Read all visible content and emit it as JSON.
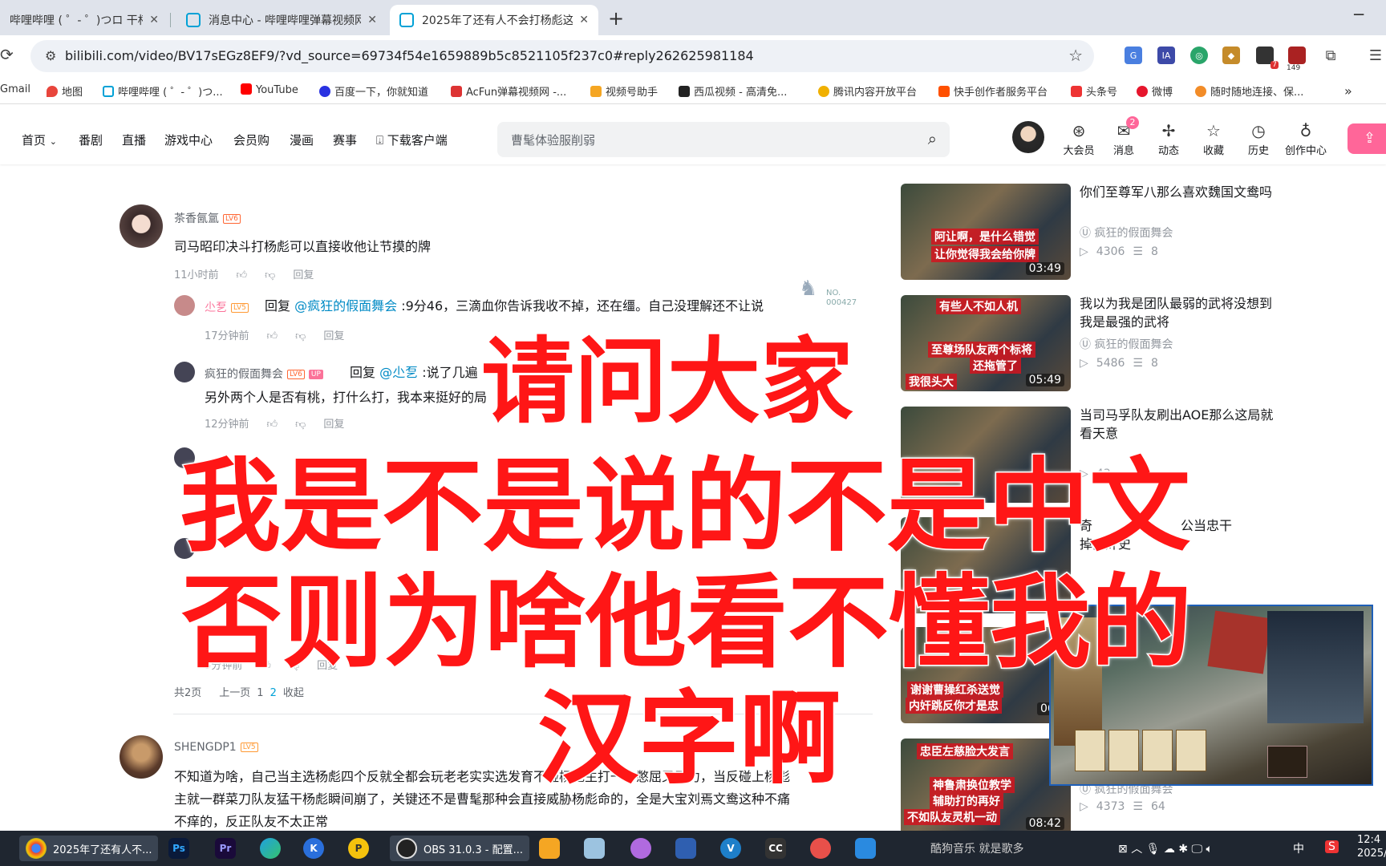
{
  "browser": {
    "tabs": [
      {
        "title": "哔哩哔哩 ( ゜- ゜)つロ 干杯~-bi",
        "close": "✕"
      },
      {
        "title": "消息中心 - 哔哩哔哩弹幕视频网",
        "close": "✕"
      },
      {
        "title": "2025年了还有人不会打杨彪这",
        "close": "✕"
      }
    ],
    "new_tab": "+",
    "minimize": "─",
    "url": "bilibili.com/video/BV17sEGz8EF9/?vd_source=69734f54e1659889b5c8521105f237c0#reply262625981184",
    "ext_badges": {
      "notif": "7",
      "count": "149"
    },
    "bookmarks": [
      "Gmail",
      "地图",
      "哔哩哔哩 ( ゜- ゜)つ...",
      "YouTube",
      "百度一下，你就知道",
      "AcFun弹幕视频网 -...",
      "视频号助手",
      "西瓜视频 - 高清免...",
      "腾讯内容开放平台",
      "快手创作者服务平台",
      "头条号",
      "微博",
      "随时随地连接、保..."
    ],
    "bookmarks_more": "»"
  },
  "header": {
    "nav": [
      "首页",
      "番剧",
      "直播",
      "游戏中心",
      "会员购",
      "漫画",
      "赛事",
      "下载客户端"
    ],
    "search_placeholder": "曹髦体验服削弱",
    "icons": [
      {
        "label": "大会员",
        "glyph": "⊛"
      },
      {
        "label": "消息",
        "glyph": "✉",
        "badge": "2"
      },
      {
        "label": "动态",
        "glyph": "✢"
      },
      {
        "label": "收藏",
        "glyph": "☆"
      },
      {
        "label": "历史",
        "glyph": "◷"
      },
      {
        "label": "创作中心",
        "glyph": "♁"
      }
    ]
  },
  "comments": {
    "main": {
      "user": "茶香氤氲",
      "level": "LV6",
      "text": "司马昭印决斗打杨彪可以直接收他让节摸的牌",
      "time": "11小时前",
      "reply": "回复",
      "fan_no": "NO.",
      "fan_id": "000427"
    },
    "replies": [
      {
        "user": "尐乭",
        "level": "LV5",
        "prefix": "回复",
        "at": "@疯狂的假面舞会",
        "text": ":9分46，三滴血你告诉我收不掉，还在缰。自己没理解还不让说",
        "time": "17分钟前",
        "reply": "回复"
      },
      {
        "user": "疯狂的假面舞会",
        "level": "LV6",
        "up": "UP",
        "prefix": "回复",
        "at": "@尐乭",
        "text": ":说了几遍",
        "text2": "另外两个人是否有桃，打什么打，我本来挺好的局",
        "time": "12分钟前",
        "reply": "回复"
      },
      {
        "time": "5分钟前",
        "reply": "回复"
      }
    ],
    "pager": {
      "total": "共2页",
      "prev": "上一页",
      "p1": "1",
      "p2": "2",
      "collapse": "收起"
    },
    "second": {
      "user": "SHENGDP1",
      "level": "LV5",
      "line1": "不知道为啥，自己当主选杨彪四个反就全都会玩老老实实选发育不碰杨彪主打一个憋屈又无力，当反碰上杨彪",
      "line2": "主就一群菜刀队友猛干杨彪瞬间崩了，关键还不是曹髦那种会直接威胁杨彪命的，全是大宝刘焉文鸯这种不痛",
      "line3": "不痒的，反正队友不太正常"
    }
  },
  "recommend": [
    {
      "title": "你们至尊军八那么喜欢魏国文鸯吗",
      "up": "疯狂的假面舞会",
      "views": "4306",
      "danmaku": "8",
      "duration": "03:49",
      "cap1": "阿让啊，是什么错觉",
      "cap2": "让你觉得我会给你牌"
    },
    {
      "title": "我以为我是团队最弱的武将没想到我是最强的武将",
      "up": "疯狂的假面舞会",
      "views": "5486",
      "danmaku": "8",
      "duration": "05:49",
      "cap1": "有些人不如人机",
      "cap2": "至尊场队友两个标将",
      "cap3": "还拖管了",
      "cap4": "我很头大"
    },
    {
      "title": "当司马孚队友刷出AOE那么这局就看天意",
      "views": "43",
      "duration": ""
    },
    {
      "title": "奇",
      "title2": "公当忠干",
      "title3": "掉内奸史",
      "duration": "06",
      "cap1": "谢谢曹操红杀送觉",
      "cap2": "内奸跳反你才是忠"
    },
    {
      "title": "",
      "up": "疯狂的假面舞会",
      "views": "4373",
      "danmaku": "64",
      "duration": "08:42",
      "cap1": "忠臣左慈脸大发言",
      "cap2": "神鲁肃换位教学",
      "cap3": "辅助打的再好",
      "cap4": "不如队友灵机一动"
    }
  ],
  "meme": [
    "请问大家",
    "我是不是说的不是中文",
    "否则为啥他看不懂我的",
    "汉字啊"
  ],
  "taskbar": {
    "active_app": "2025年了还有人不...",
    "obs": "OBS 31.0.3 - 配置...",
    "music": "酷狗音乐 就是歌多",
    "ime": "中",
    "clock": "12:4",
    "date": "2025/"
  },
  "colors": {
    "bili_pink": "#ff6699",
    "bili_blue": "#00a1d6",
    "meme_red": "#ff1616"
  }
}
